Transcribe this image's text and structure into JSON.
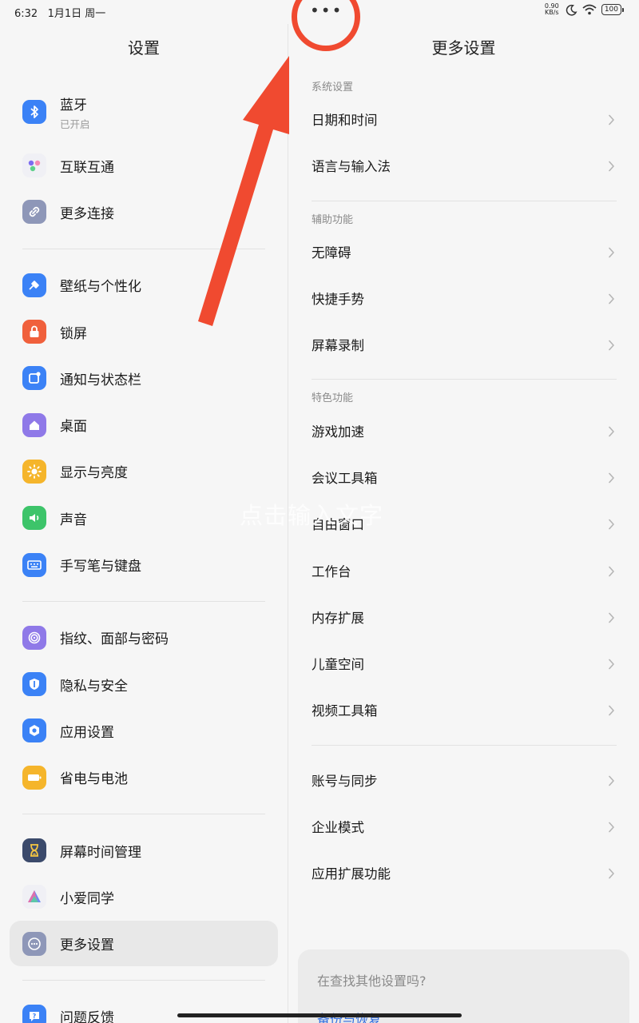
{
  "status_bar": {
    "time": "6:32",
    "date": "1月1日 周一",
    "net_speed_value": "0.90",
    "net_speed_unit": "KB/s",
    "battery": "100"
  },
  "left": {
    "title": "设置",
    "groups": [
      [
        {
          "label": "蓝牙",
          "sub": "已开启",
          "icon": "bluetooth-icon",
          "color": "#3b82f6"
        },
        {
          "label": "互联互通",
          "icon": "interconnect-icon",
          "color": "#f0f0f5"
        },
        {
          "label": "更多连接",
          "icon": "link-icon",
          "color": "#8e97b8"
        }
      ],
      [
        {
          "label": "壁纸与个性化",
          "icon": "wallpaper-icon",
          "color": "#3b82f6"
        },
        {
          "label": "锁屏",
          "icon": "lock-icon",
          "color": "#f0603c"
        },
        {
          "label": "通知与状态栏",
          "icon": "notification-icon",
          "color": "#3b82f6"
        },
        {
          "label": "桌面",
          "icon": "home-icon",
          "color": "#8f79e8"
        },
        {
          "label": "显示与亮度",
          "icon": "brightness-icon",
          "color": "#f5b52b"
        },
        {
          "label": "声音",
          "icon": "sound-icon",
          "color": "#3dc46a"
        },
        {
          "label": "手写笔与键盘",
          "icon": "keyboard-icon",
          "color": "#3b82f6"
        }
      ],
      [
        {
          "label": "指纹、面部与密码",
          "icon": "fingerprint-icon",
          "color": "#8f79e8"
        },
        {
          "label": "隐私与安全",
          "icon": "privacy-icon",
          "color": "#3b82f6"
        },
        {
          "label": "应用设置",
          "icon": "app-settings-icon",
          "color": "#3b82f6"
        },
        {
          "label": "省电与电池",
          "icon": "battery-icon",
          "color": "#f5b52b"
        }
      ],
      [
        {
          "label": "屏幕时间管理",
          "icon": "hourglass-icon",
          "color": "#3b4a6b"
        },
        {
          "label": "小爱同学",
          "icon": "xiaoai-icon",
          "color": "#f0f0f5"
        },
        {
          "label": "更多设置",
          "icon": "more-icon",
          "color": "#8e97b8",
          "selected": true
        }
      ],
      [
        {
          "label": "问题反馈",
          "icon": "feedback-icon",
          "color": "#3b82f6"
        }
      ]
    ]
  },
  "right": {
    "title": "更多设置",
    "sections": [
      {
        "header": "系统设置",
        "items": [
          "日期和时间",
          "语言与输入法"
        ]
      },
      {
        "header": "辅助功能",
        "items": [
          "无障碍",
          "快捷手势",
          "屏幕录制"
        ]
      },
      {
        "header": "特色功能",
        "items": [
          "游戏加速",
          "会议工具箱",
          "自由窗口",
          "工作台",
          "内存扩展",
          "儿童空间",
          "视频工具箱"
        ]
      },
      {
        "header": "",
        "items": [
          "账号与同步",
          "企业模式",
          "应用扩展功能"
        ]
      }
    ],
    "search_card": {
      "question": "在查找其他设置吗?",
      "link": "备份与恢复"
    }
  },
  "watermark": "点击输入文字",
  "more_menu": "•••"
}
